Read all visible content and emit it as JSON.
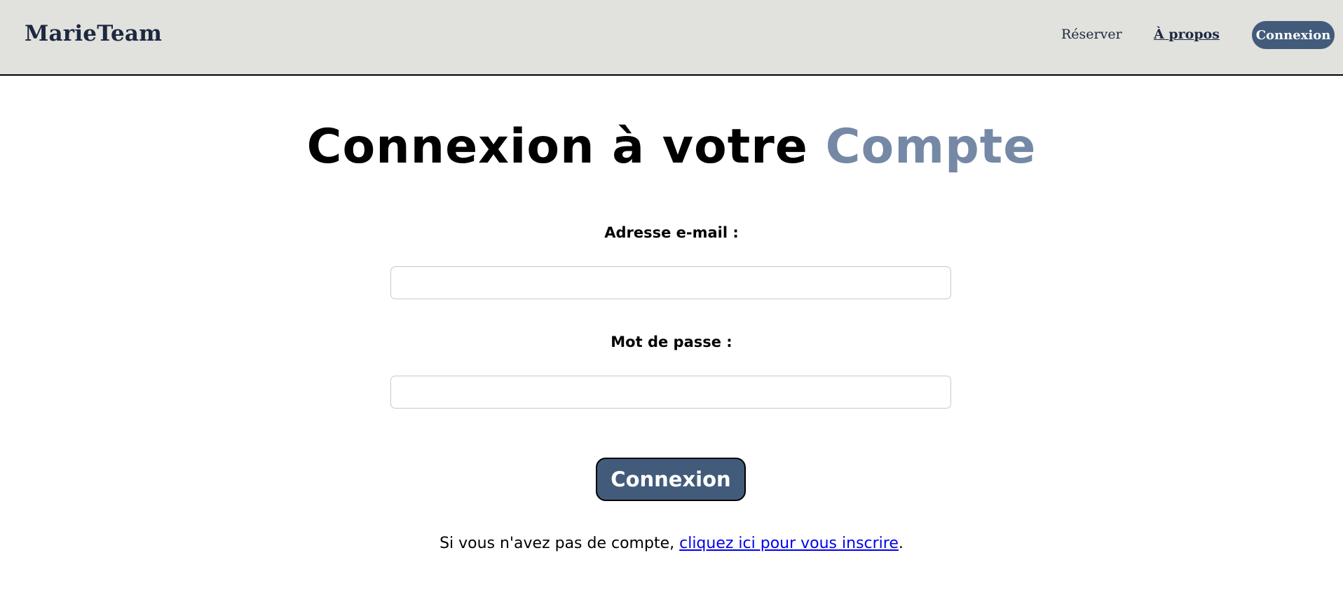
{
  "header": {
    "brand": "MarieTeam",
    "nav": {
      "reserver": "Réserver",
      "apropos": "À propos",
      "connexion": "Connexion"
    }
  },
  "main": {
    "title_part1": "Connexion à votre ",
    "title_part2": "Compte",
    "email_label": "Adresse e-mail :",
    "email_value": "",
    "password_label": "Mot de passe :",
    "password_value": "",
    "submit_label": "Connexion",
    "footer_prefix": "Si vous n'avez pas de compte, ",
    "footer_link": "cliquez ici pour vous inscrire",
    "footer_suffix": "."
  },
  "colors": {
    "accent": "#7589a6",
    "button": "#425b7b",
    "header_bg": "#e1e1dd",
    "brand": "#1d2840",
    "link": "#0000ee"
  }
}
